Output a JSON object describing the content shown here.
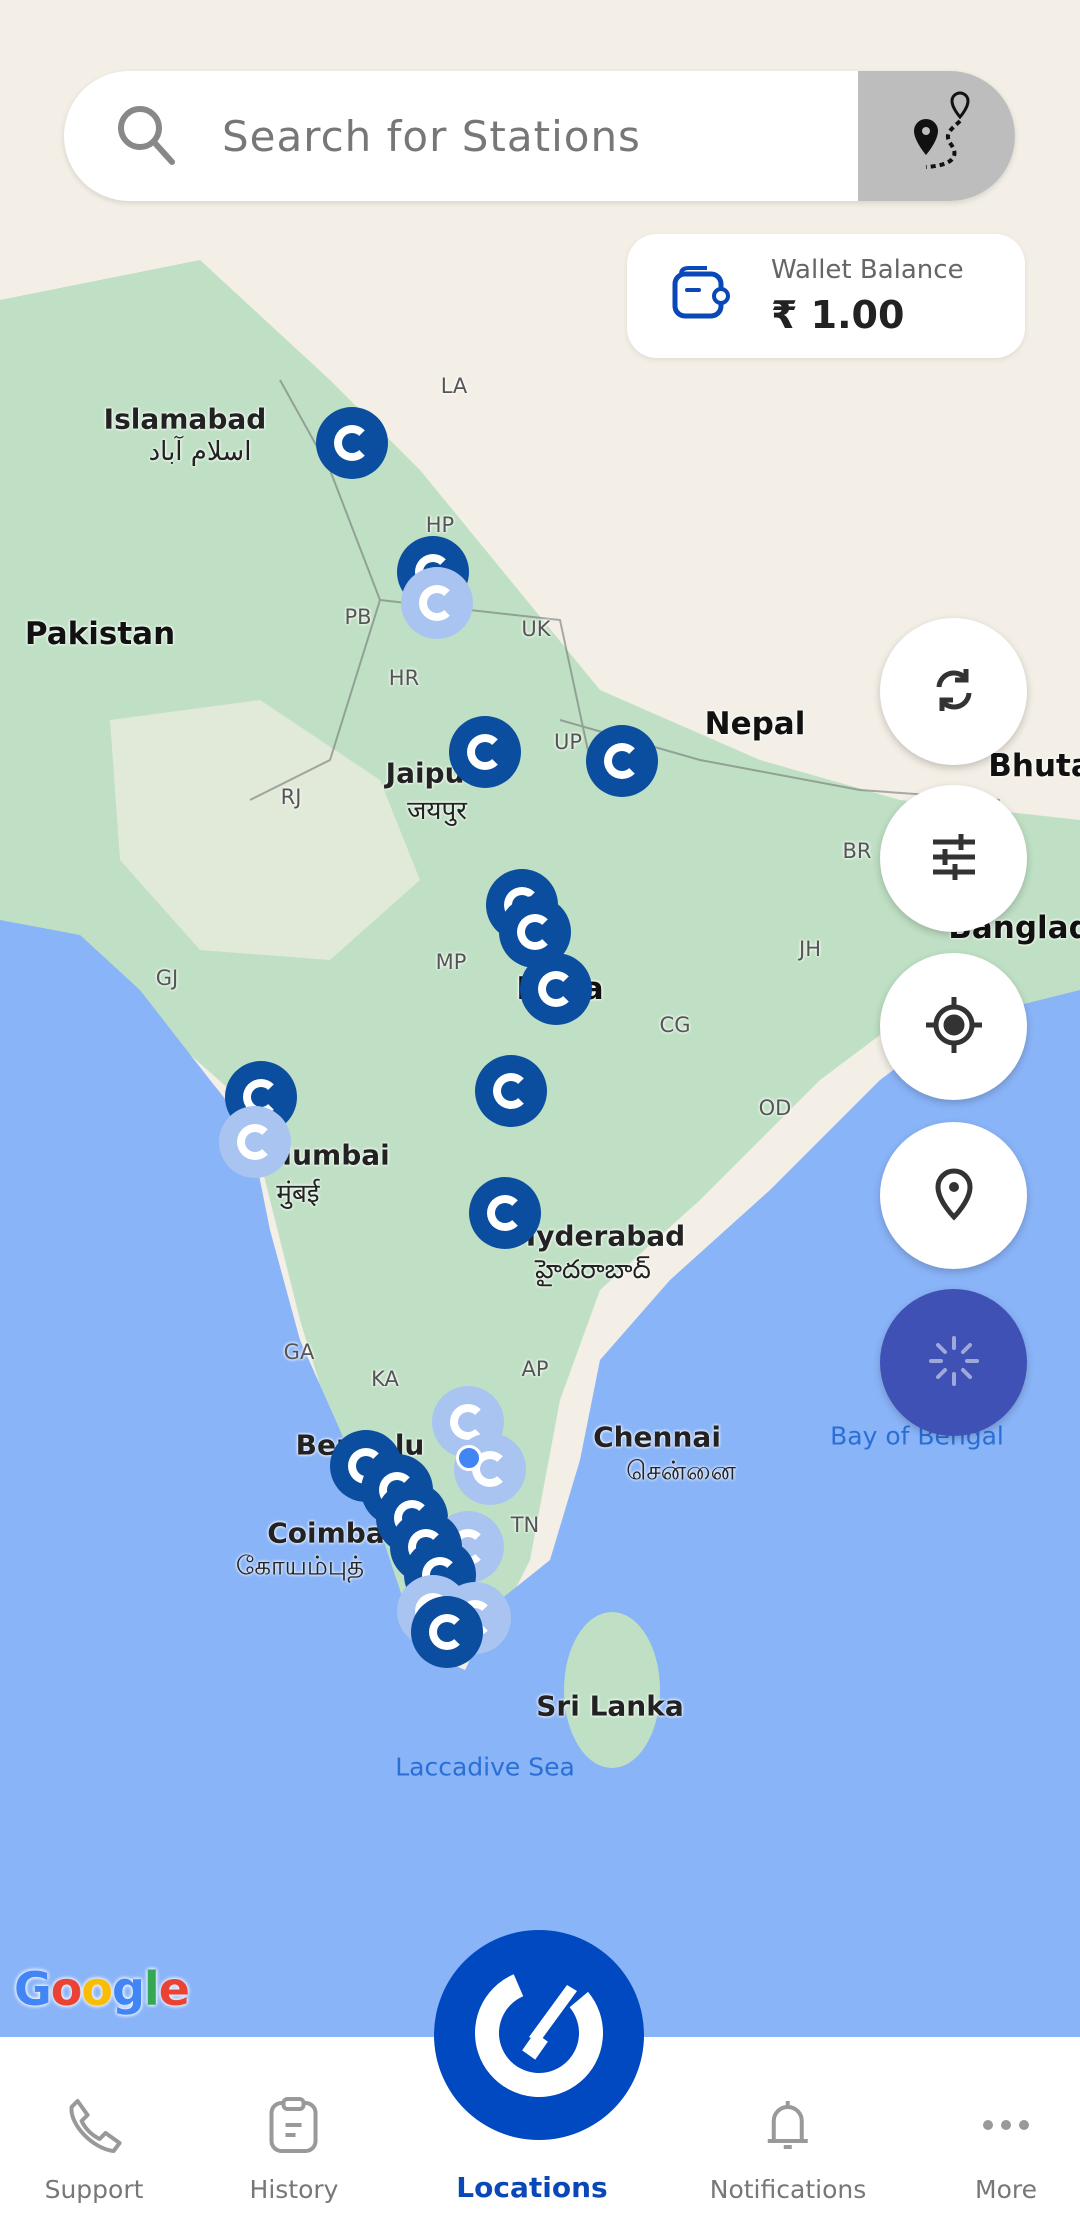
{
  "search": {
    "placeholder": "Search for Stations",
    "search_icon": "search-icon",
    "route_icon": "route-pins-icon"
  },
  "wallet": {
    "label": "Wallet Balance",
    "amount": "₹ 1.00",
    "icon": "wallet-icon"
  },
  "fabs": [
    {
      "icon": "refresh-icon"
    },
    {
      "icon": "filter-sliders-icon"
    },
    {
      "icon": "my-location-icon"
    },
    {
      "icon": "location-pin-icon"
    },
    {
      "icon": "loading-spinner-icon"
    }
  ],
  "map": {
    "colors": {
      "sea": "#8ab4f8",
      "land": "#f3efe6",
      "green": "#bfe0c4",
      "marker": "#0b4d9e",
      "marker_light": "#a9c4f1"
    },
    "labels": {
      "islamabad": "Islamabad",
      "islamabad_ur": "اسلام آباد",
      "pakistan": "Pakistan",
      "la": "LA",
      "hp": "HP",
      "pb": "PB",
      "uk": "UK",
      "hr": "HR",
      "up": "UP",
      "nepal": "Nepal",
      "bhutan": "Bhuta",
      "rj": "RJ",
      "jaipur": "Jaipur",
      "jaipur_hi": "जयपुर",
      "br": "BR",
      "mp": "MP",
      "india": "India",
      "jh": "JH",
      "cg": "CG",
      "gj": "GJ",
      "od": "OD",
      "bangladesh": "Banglade",
      "mumbai": "Mumbai",
      "mumbai_hi": "मुंबई",
      "hyderabad": "Hyderabad",
      "hyderabad_te": "హైదరాబాద్",
      "ga": "GA",
      "ka": "KA",
      "ap": "AP",
      "chennai": "Chennai",
      "chennai_ta": "சென்னை",
      "bengaluru": "Bengalu",
      "coimbatore": "Coimba",
      "coimbatore_ta": "கோயம்புத்",
      "tn": "TN",
      "srilanka": "Sri Lanka",
      "laccadive": "Laccadive Sea",
      "bay": "Bay of Bengal"
    },
    "attribution": "Google"
  },
  "nav": {
    "items": [
      {
        "label": "Support",
        "icon": "phone-icon"
      },
      {
        "label": "History",
        "icon": "clipboard-icon"
      },
      {
        "label": "Locations",
        "icon": "brand-logo-icon",
        "active": true
      },
      {
        "label": "Notifications",
        "icon": "bell-icon"
      },
      {
        "label": "More",
        "icon": "more-dots-icon"
      }
    ]
  }
}
